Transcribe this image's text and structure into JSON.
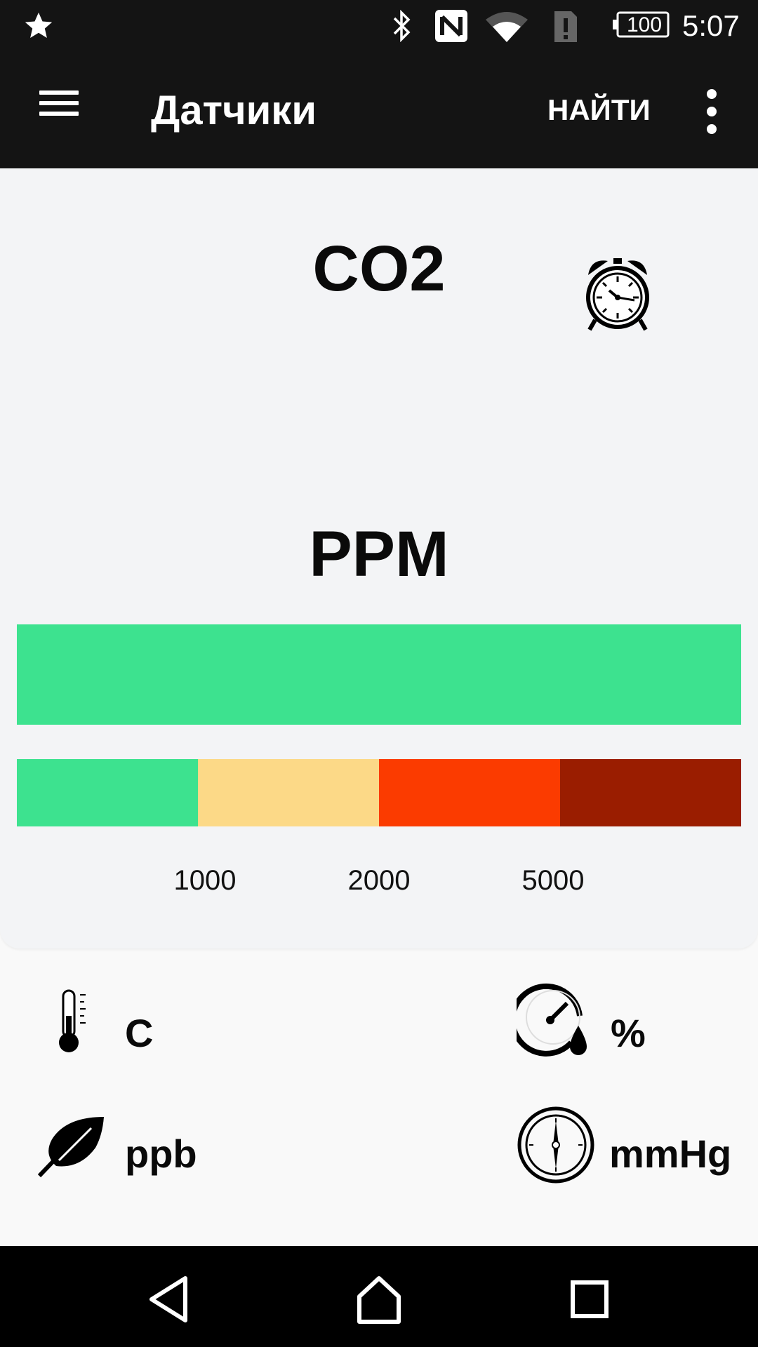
{
  "status_bar": {
    "notification_icon": "star-icon",
    "icons": [
      "bluetooth-icon",
      "nfc-icon",
      "wifi-icon",
      "sim-alert-icon",
      "battery-icon"
    ],
    "battery_level": "100",
    "time": "5:07"
  },
  "app_bar": {
    "title": "Датчики",
    "menu_icon": "hamburger-menu-icon",
    "find_label": "НАЙТИ",
    "more_icon": "more-vert-icon"
  },
  "sensor_card": {
    "name": "CO2",
    "alarm_icon": "alarm-clock-icon",
    "unit": "PPM",
    "level_color": "#3de28f",
    "scale_colors": [
      "#3de28f",
      "#fcd987",
      "#fb3b00",
      "#9a1d00"
    ],
    "scale_ticks": [
      "1000",
      "2000",
      "5000"
    ]
  },
  "sensors": [
    {
      "icon": "thermometer-icon",
      "unit": "C"
    },
    {
      "icon": "humidity-gauge-icon",
      "unit": "%"
    },
    {
      "icon": "leaf-icon",
      "unit": "ppb"
    },
    {
      "icon": "barometer-icon",
      "unit": "mmHg"
    }
  ],
  "nav_bar": {
    "back_icon": "back-icon",
    "home_icon": "home-icon",
    "recents_icon": "recents-icon"
  },
  "colors": {
    "bar_background": "#141414",
    "card_background": "#f3f4f6",
    "page_background": "#f9f9f9"
  }
}
